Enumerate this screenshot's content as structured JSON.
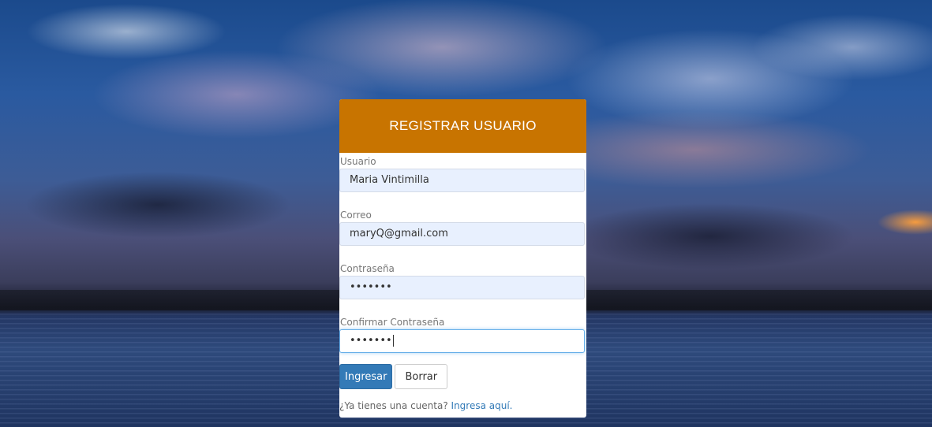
{
  "form": {
    "title": "REGISTRAR USUARIO",
    "fields": {
      "usuario": {
        "label": "Usuario",
        "value": "Maria Vintimilla"
      },
      "correo": {
        "label": "Correo",
        "value": "maryQ@gmail.com"
      },
      "contrasena": {
        "label": "Contraseña",
        "value": "•••••••"
      },
      "confirmar": {
        "label": "Confirmar Contraseña",
        "value": "•••••••"
      }
    },
    "buttons": {
      "submit": "Ingresar",
      "clear": "Borrar"
    },
    "footer": {
      "prompt": "¿Ya tienes una cuenta?",
      "link": "Ingresa aquí."
    }
  },
  "colors": {
    "header": "#c87400",
    "primary_button": "#337ab7",
    "input_autofill": "#e8f0fe"
  }
}
